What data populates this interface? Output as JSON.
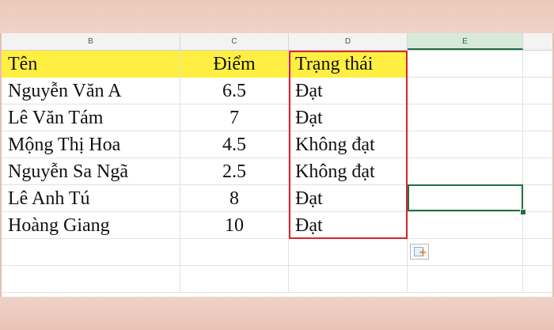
{
  "columns": [
    "B",
    "C",
    "D",
    "E"
  ],
  "header": {
    "name": "Tên",
    "score": "Điểm",
    "status": "Trạng thái"
  },
  "rows": [
    {
      "name": "Nguyễn Văn A",
      "score": "6.5",
      "status": "Đạt"
    },
    {
      "name": "Lê Văn Tám",
      "score": "7",
      "status": "Đạt"
    },
    {
      "name": "Mộng Thị Hoa",
      "score": "4.5",
      "status": "Không đạt"
    },
    {
      "name": "Nguyễn Sa Ngã",
      "score": "2.5",
      "status": "Không đạt"
    },
    {
      "name": "Lê Anh Tú",
      "score": "8",
      "status": "Đạt"
    },
    {
      "name": "Hoàng Giang",
      "score": "10",
      "status": "Đạt"
    }
  ],
  "colors": {
    "header_fill": "#ffef41",
    "highlight_border": "#d9252c",
    "selection": "#1e7145"
  },
  "icons": {
    "quick_analysis": "quick-analysis-icon"
  }
}
